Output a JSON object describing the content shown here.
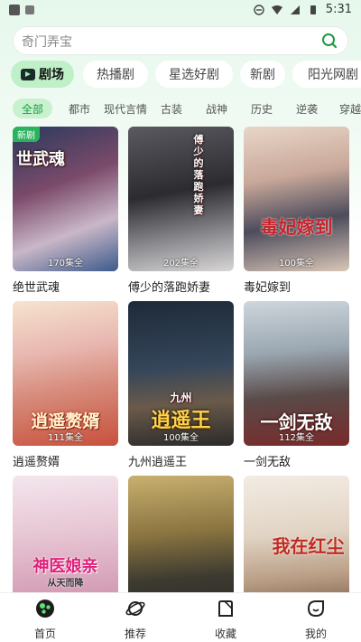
{
  "status": {
    "time": "5:31"
  },
  "search": {
    "placeholder": "奇门弄宝"
  },
  "top_tabs": [
    {
      "label": "剧场",
      "active": true
    },
    {
      "label": "热播剧"
    },
    {
      "label": "星选好剧"
    },
    {
      "label": "新剧"
    },
    {
      "label": "阳光网剧"
    }
  ],
  "categories": [
    "全部",
    "都市",
    "现代言情",
    "古装",
    "战神",
    "历史",
    "逆袭",
    "穿越"
  ],
  "dramas": [
    {
      "title": "绝世武魂",
      "episodes": "170集全",
      "poster_text": "世武魂",
      "badge": "新剧"
    },
    {
      "title": "傅少的落跑娇妻",
      "episodes": "202集全",
      "poster_text": "傅少的落跑娇妻"
    },
    {
      "title": "毒妃嫁到",
      "episodes": "100集全",
      "poster_text": "毒妃嫁到"
    },
    {
      "title": "逍遥赘婿",
      "episodes": "111集全",
      "poster_text": "逍遥赘婿"
    },
    {
      "title": "九州逍遥王",
      "episodes": "100集全",
      "poster_text": "逍遥王",
      "poster_subtext": "九州"
    },
    {
      "title": "一剑无敌",
      "episodes": "112集全",
      "poster_text": "一剑无敌"
    },
    {
      "title": "",
      "episodes": "",
      "poster_text": "神医娘亲",
      "poster_subtext": "从天而降"
    },
    {
      "title": "",
      "episodes": "",
      "poster_text": ""
    },
    {
      "title": "",
      "episodes": "",
      "poster_text": "我在红尘"
    }
  ],
  "bottom_nav": [
    {
      "label": "首页",
      "active": true
    },
    {
      "label": "推荐"
    },
    {
      "label": "收藏"
    },
    {
      "label": "我的"
    }
  ],
  "colors": {
    "accent": "#1c9a44",
    "tab_active": "#bff0c8",
    "badge": "#2ab35e"
  }
}
